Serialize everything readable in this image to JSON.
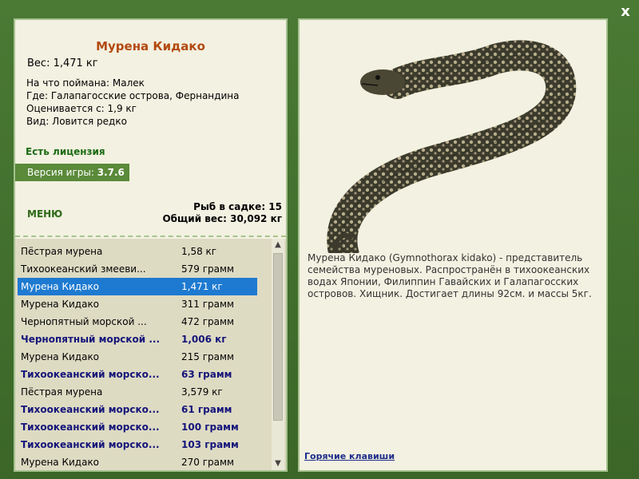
{
  "close": {
    "label": "x"
  },
  "fish": {
    "title": "Мурена Кидако",
    "weight": "Вес: 1,471 кг",
    "bait": "На что поймана: Малек",
    "place": "Где: Галапагосские острова, Фернандина",
    "price": "Оценивается с: 1,9 кг",
    "type": "Вид: Ловится редко",
    "description": "Мурена Кидако (Gymnothorax kidako) - представитель семейства муреновых. Распространён в тихоокеанских водах Японии, Филиппин Гавайских и Галапагосских островов. Хищник. Достигает длины 92см. и массы 5кг."
  },
  "license": "Есть лицензия",
  "version": {
    "label": "Версия игры:",
    "value": "3.7.6"
  },
  "menu": "МЕНЮ",
  "stats": {
    "count": "Рыб в садке: 15",
    "total": "Общий вес: 30,092 кг"
  },
  "list": [
    {
      "name": "Пёстрая мурена",
      "weight": "1,58 кг"
    },
    {
      "name": "Тихоокеанский змееви...",
      "weight": "579 грамм"
    },
    {
      "name": "Мурена Кидако",
      "weight": "1,471 кг"
    },
    {
      "name": "Мурена Кидако",
      "weight": "311 грамм"
    },
    {
      "name": "Чернопятный морской ...",
      "weight": "472 грамм"
    },
    {
      "name": "Чернопятный морской ...",
      "weight": "1,006 кг"
    },
    {
      "name": "Мурена Кидако",
      "weight": "215 грамм"
    },
    {
      "name": "Тихоокеанский морско...",
      "weight": "63 грамм"
    },
    {
      "name": "Пёстрая мурена",
      "weight": "3,579 кг"
    },
    {
      "name": "Тихоокеанский морско...",
      "weight": "61 грамм"
    },
    {
      "name": "Тихоокеанский морско...",
      "weight": "100 грамм"
    },
    {
      "name": "Тихоокеанский морско...",
      "weight": "103 грамм"
    },
    {
      "name": "Мурена Кидако",
      "weight": "270 грамм"
    }
  ],
  "hotkeys": "Горячие клавиши"
}
